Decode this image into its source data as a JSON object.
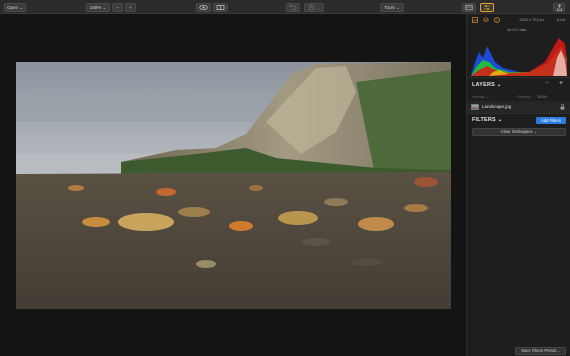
{
  "toolbar": {
    "open_label": "Open",
    "zoom_label": "168%",
    "zoom_out_label": "−",
    "zoom_in_label": "+",
    "undo_icon": "undo-icon",
    "history_icon": "history-icon",
    "tools_label": "Tools",
    "chevron": "⌄"
  },
  "panel": {
    "image_size": "1326 x 753 px",
    "bit_depth": "8-bit",
    "color_space": "No ICC data",
    "layers_title": "LAYERS",
    "layer_mode": "Normal",
    "opacity_label": "Opacity:",
    "opacity_value": "100%",
    "layer_name": "Landscape.jpg",
    "filters_title": "FILTERS",
    "add_filters_label": "Add Filters",
    "clear_workspace_label": "Clear Workspace",
    "save_preset_label": "Save Filters Preset..."
  },
  "colors": {
    "accent": "#2d7ae0",
    "icon_orange": "#f0a030"
  }
}
